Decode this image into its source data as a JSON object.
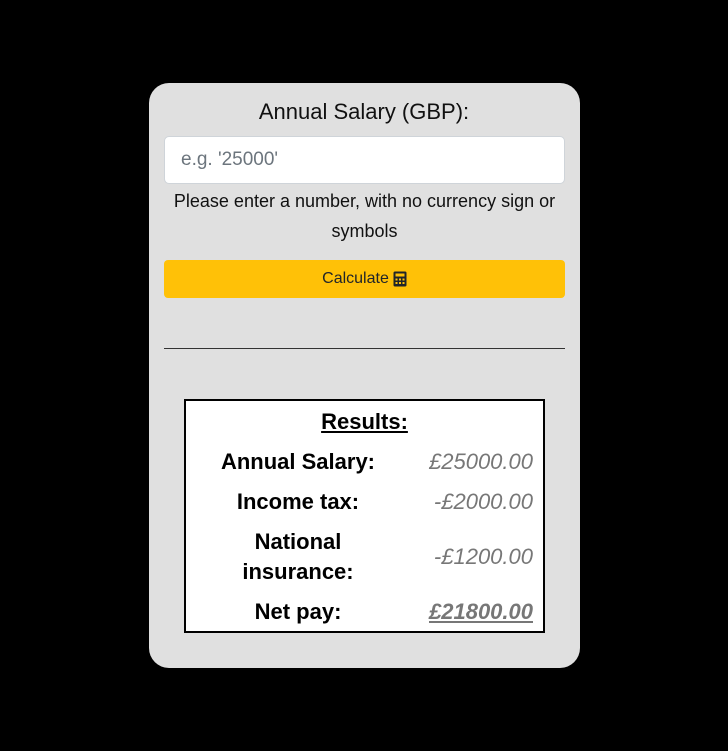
{
  "form": {
    "title": "Annual Salary (GBP):",
    "input_placeholder": "e.g. '25000'",
    "input_value": "",
    "hint": "Please enter a number, with no currency sign or symbols",
    "calculate_label": "Calculate",
    "calculate_icon": "calculator-icon",
    "accent_color": "#ffc107"
  },
  "results": {
    "heading": "Results:",
    "rows": [
      {
        "label": "Annual Salary:",
        "value": "£25000.00"
      },
      {
        "label": "Income tax:",
        "value": "-£2000.00"
      },
      {
        "label": "National insurance:",
        "value": "-£1200.00"
      },
      {
        "label": "Net pay:",
        "value": "£21800.00"
      }
    ]
  }
}
